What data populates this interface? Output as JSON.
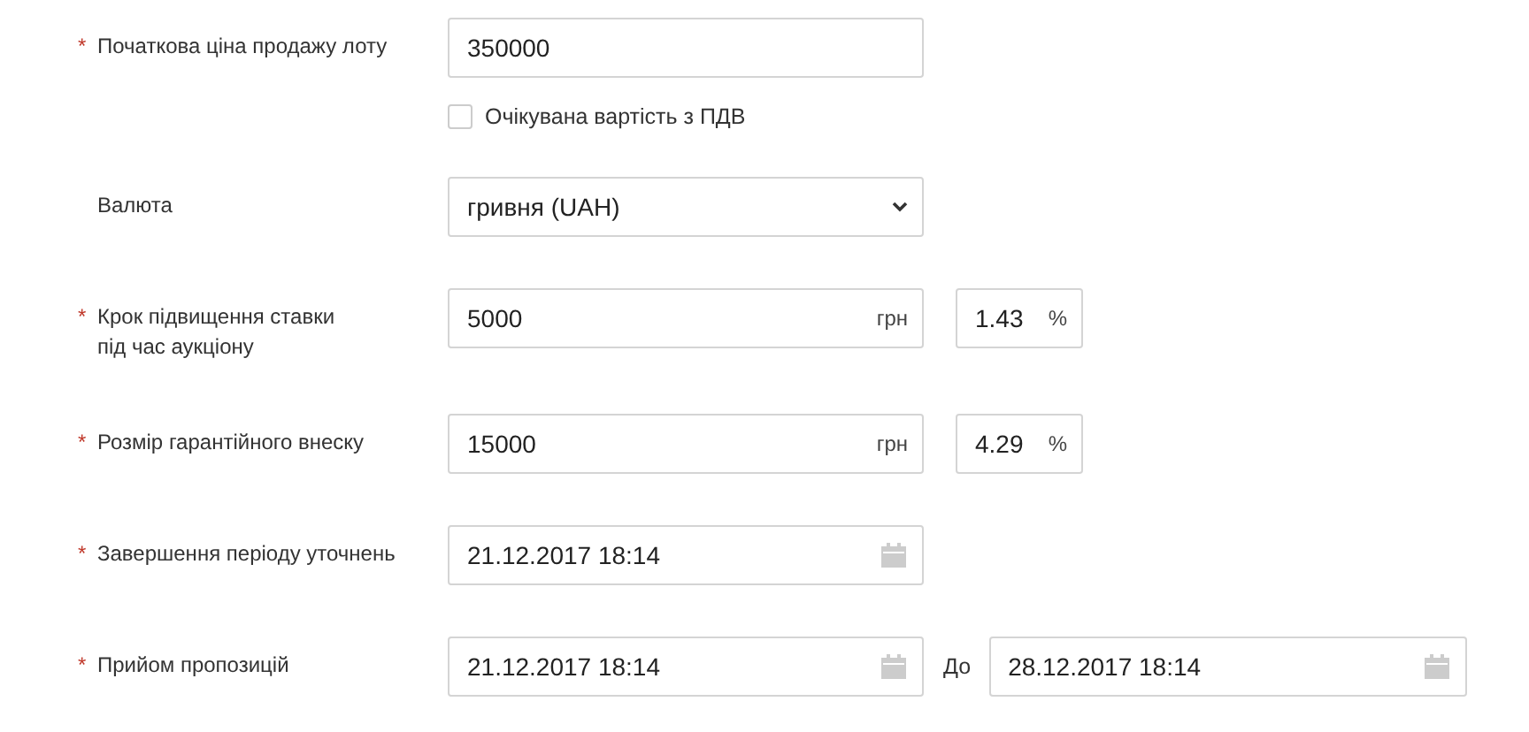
{
  "rows": [
    {
      "kind": "input",
      "marker": "*",
      "label": "Початкова ціна продажу лоту",
      "value": "350000"
    },
    {
      "kind": "checkbox",
      "label": "Очікувана вартість з ПДВ",
      "checked": false
    },
    {
      "kind": "select",
      "label": "Валюта",
      "value": "гривня (UAH)"
    },
    {
      "kind": "amount",
      "marker": "*",
      "label": "Крок підвищення ставки\nпід час аукціону",
      "value": "5000",
      "unit": "грн",
      "percent": "1.43",
      "percent_unit": "%"
    },
    {
      "kind": "amount",
      "marker": "*",
      "label": "Розмір гарантійного внеску",
      "value": "15000",
      "unit": "грн",
      "percent": "4.29",
      "percent_unit": "%"
    },
    {
      "kind": "date",
      "marker": "*",
      "label": "Завершення періоду уточнень",
      "value": "21.12.2017 18:14"
    },
    {
      "kind": "date_range",
      "marker": "*",
      "label": "Прийом пропозицій",
      "value": "21.12.2017 18:14",
      "separator": "До",
      "value_to": "28.12.2017 18:14"
    }
  ]
}
